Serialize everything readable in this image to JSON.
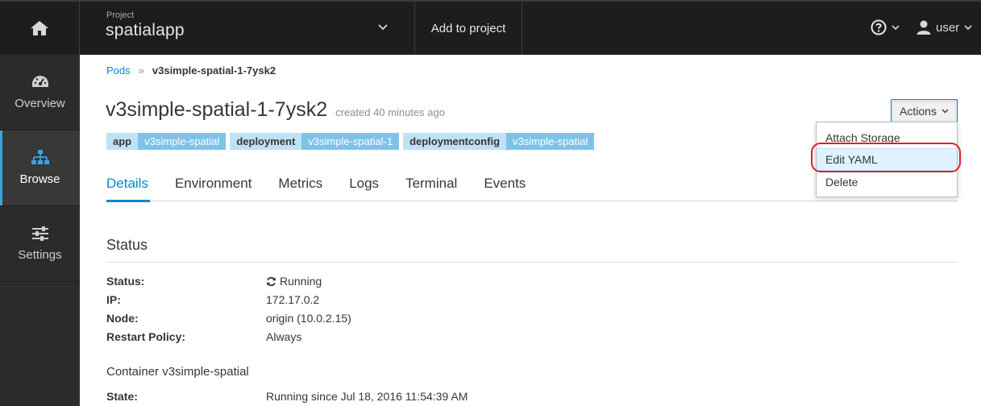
{
  "topbar": {
    "project_caption": "Project",
    "project_name": "spatialapp",
    "add_to_project": "Add to project",
    "user_label": "user"
  },
  "sidebar": {
    "items": [
      {
        "label": "Overview",
        "icon": "dashboard-icon"
      },
      {
        "label": "Browse",
        "icon": "sitemap-icon",
        "active": true
      },
      {
        "label": "Settings",
        "icon": "sliders-icon"
      }
    ]
  },
  "breadcrumb": {
    "parent": "Pods",
    "separator": "»",
    "current": "v3simple-spatial-1-7ysk2"
  },
  "page": {
    "title": "v3simple-spatial-1-7ysk2",
    "created": "created 40 minutes ago",
    "actions_label": "Actions"
  },
  "labels": [
    {
      "key": "app",
      "value": "v3simple-spatial"
    },
    {
      "key": "deployment",
      "value": "v3simple-spatial-1"
    },
    {
      "key": "deploymentconfig",
      "value": "v3simple-spatial"
    }
  ],
  "tabs": [
    "Details",
    "Environment",
    "Metrics",
    "Logs",
    "Terminal",
    "Events"
  ],
  "status": {
    "section_title": "Status",
    "rows": [
      {
        "key": "Status:",
        "value": "Running"
      },
      {
        "key": "IP:",
        "value": "172.17.0.2"
      },
      {
        "key": "Node:",
        "value": "origin (10.0.2.15)"
      },
      {
        "key": "Restart Policy:",
        "value": "Always"
      }
    ]
  },
  "container": {
    "title": "Container v3simple-spatial",
    "state_key": "State:",
    "state_value": "Running since Jul 18, 2016 11:54:39 AM"
  },
  "dropdown": {
    "items": [
      "Attach Storage",
      "Edit YAML",
      "Delete"
    ]
  },
  "colors": {
    "accent": "#0088ce",
    "label_key_bg": "#bee1f4",
    "label_val_bg": "#7dc3e8",
    "highlight_ring": "#e0202a"
  }
}
